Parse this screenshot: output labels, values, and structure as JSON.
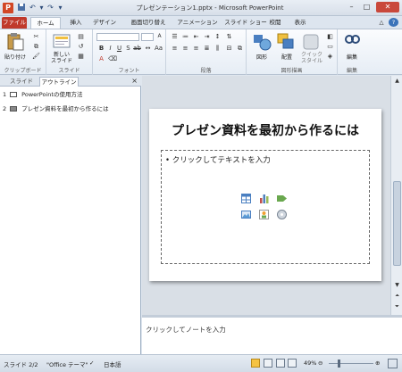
{
  "window": {
    "title": "プレゼンテーション1.pptx - Microsoft PowerPoint",
    "app_icon": "P"
  },
  "ribbon_tabs": [
    {
      "label": "ファイル"
    },
    {
      "label": "ホーム"
    },
    {
      "label": "挿入"
    },
    {
      "label": "デザイン"
    },
    {
      "label": "画面切り替え"
    },
    {
      "label": "アニメーション"
    },
    {
      "label": "スライド ショー"
    },
    {
      "label": "校閲"
    },
    {
      "label": "表示"
    }
  ],
  "ribbon": {
    "groups": {
      "clipboard": "クリップボード",
      "slides": "スライド",
      "font": "フォント",
      "paragraph": "段落",
      "drawing": "図形描画",
      "editing": "編集"
    },
    "paste_label": "貼り付け",
    "new_slide_label": "新しい\nスライド",
    "shapes_label": "図形",
    "arrange_label": "配置",
    "quick_styles_label": "クイック\nスタイル",
    "editing_label": "編集"
  },
  "left_pane": {
    "tabs": [
      "スライド",
      "アウトライン"
    ],
    "active_tab": "アウトライン",
    "outline_items": [
      {
        "num": "1",
        "text": "PowerPointの使用方法"
      },
      {
        "num": "2",
        "text": "プレゼン資料を最初から作るには"
      }
    ]
  },
  "slide": {
    "title": "プレゼン資料を最初から作るには",
    "content_placeholder": "クリックしてテキストを入力"
  },
  "notes": {
    "placeholder": "クリックしてノートを入力"
  },
  "status": {
    "slide_info": "スライド 2/2",
    "theme": "\"Office テーマ\"",
    "language": "日本語",
    "zoom": "49%"
  },
  "colors": {
    "file_tab": "#c0392b",
    "ppt_brand": "#d24726",
    "ribbon_bg": "#e6edf5"
  }
}
